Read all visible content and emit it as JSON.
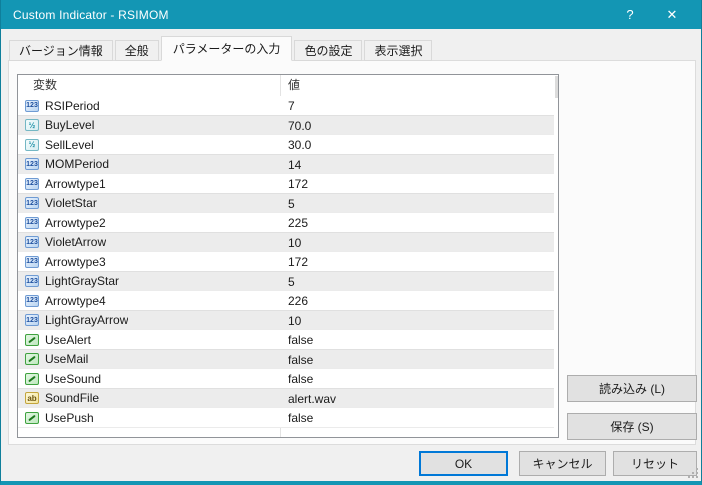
{
  "window": {
    "title": "Custom Indicator - RSIMOM",
    "help_glyph": "?",
    "close_glyph": "✕"
  },
  "tabs": [
    {
      "label": "バージョン情報",
      "active": false
    },
    {
      "label": "全般",
      "active": false
    },
    {
      "label": "パラメーターの入力",
      "active": true
    },
    {
      "label": "色の設定",
      "active": false
    },
    {
      "label": "表示選択",
      "active": false
    }
  ],
  "table": {
    "headers": [
      "変数",
      "値"
    ],
    "rows": [
      {
        "name": "RSIPeriod",
        "value": "7",
        "type": "int"
      },
      {
        "name": "BuyLevel",
        "value": "70.0",
        "type": "double"
      },
      {
        "name": "SellLevel",
        "value": "30.0",
        "type": "double"
      },
      {
        "name": "MOMPeriod",
        "value": "14",
        "type": "int"
      },
      {
        "name": "Arrowtype1",
        "value": "172",
        "type": "int"
      },
      {
        "name": "VioletStar",
        "value": "5",
        "type": "int"
      },
      {
        "name": "Arrowtype2",
        "value": "225",
        "type": "int"
      },
      {
        "name": "VioletArrow",
        "value": "10",
        "type": "int"
      },
      {
        "name": "Arrowtype3",
        "value": "172",
        "type": "int"
      },
      {
        "name": "LightGrayStar",
        "value": "5",
        "type": "int"
      },
      {
        "name": "Arrowtype4",
        "value": "226",
        "type": "int"
      },
      {
        "name": "LightGrayArrow",
        "value": "10",
        "type": "int"
      },
      {
        "name": "UseAlert",
        "value": "false",
        "type": "bool"
      },
      {
        "name": "UseMail",
        "value": "false",
        "type": "bool"
      },
      {
        "name": "UseSound",
        "value": "false",
        "type": "bool"
      },
      {
        "name": "SoundFile",
        "value": "alert.wav",
        "type": "string"
      },
      {
        "name": "UsePush",
        "value": "false",
        "type": "bool"
      }
    ]
  },
  "icons": {
    "int": "123",
    "double": "½",
    "string": "ab",
    "bool": "diagonal-line"
  },
  "side_buttons": {
    "load": "読み込み (L)",
    "save": "保存 (S)"
  },
  "bottom_buttons": {
    "ok": "OK",
    "cancel": "キャンセル",
    "reset": "リセット"
  },
  "colors": {
    "titlebar": "#1396b4",
    "accent_border": "#1396b4",
    "ok_button_border": "#0078d7",
    "dialog_background": "#f0f0f0",
    "page_background": "#fbfbfb",
    "row_stripe": "#ececec",
    "table_border": "#919499"
  }
}
